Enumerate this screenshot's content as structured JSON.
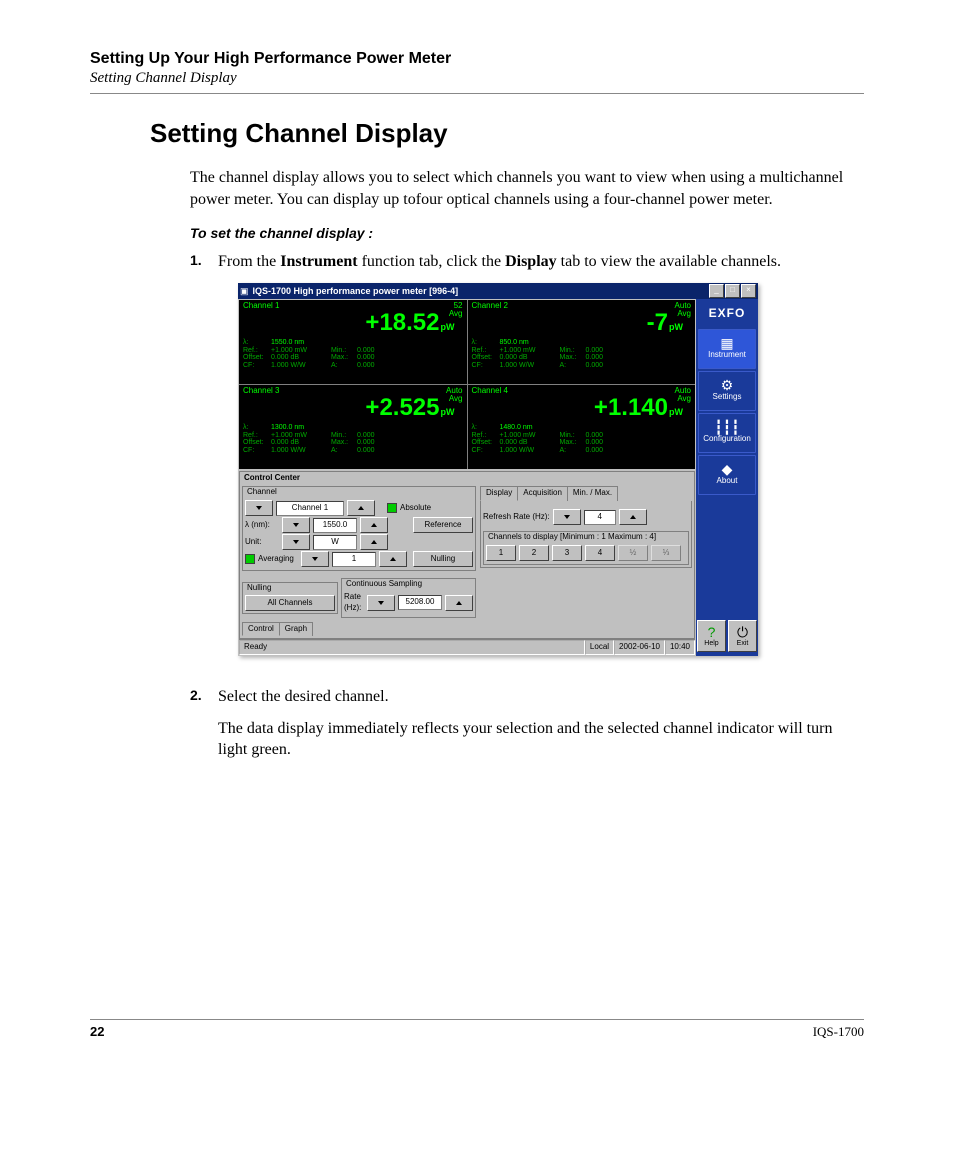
{
  "header": {
    "title": "Setting Up Your High Performance Power Meter",
    "sub": "Setting Channel Display"
  },
  "h1": "Setting Channel Display",
  "intro": "The channel display allows you to select which channels you want to view when using a multichannel power meter. You can display up tofour optical channels using a four-channel power meter.",
  "instr": "To set the channel display :",
  "step1": {
    "n": "1.",
    "pre": "From the ",
    "b1": "Instrument",
    "mid": " function tab, click the ",
    "b2": "Display",
    "post": " tab to view the available channels."
  },
  "step2": {
    "n": "2.",
    "line1": "Select the desired channel.",
    "line2": "The data display immediately reflects your selection and the selected channel indicator will turn light green."
  },
  "footer": {
    "page": "22",
    "model": "IQS-1700"
  },
  "shot": {
    "title": "IQS-1700 High performance power meter [996-4]",
    "winbtns": {
      "min": "_",
      "max": "□",
      "close": "×"
    },
    "logo": "EXFO",
    "side": [
      {
        "l": "Instrument"
      },
      {
        "l": "Settings"
      },
      {
        "l": "Configuration"
      },
      {
        "l": "About"
      }
    ],
    "help": "Help",
    "exit": "Exit",
    "channels": [
      {
        "name": "Channel 1",
        "auto1": "52",
        "auto2": "Avg",
        "value": "+18.52",
        "unit": "pW",
        "lambda": "1550.0 nm",
        "ref": "+1.000  mW",
        "off": "0.000  dB",
        "cf": "1.000  W/W",
        "min": "0.000",
        "max": "0.000",
        "a": "0.000"
      },
      {
        "name": "Channel 2",
        "auto1": "Auto",
        "auto2": "Avg",
        "value": "-7",
        "unit": "pW",
        "lambda": "850.0 nm",
        "ref": "+1.000  mW",
        "off": "0.000  dB",
        "cf": "1.000  W/W",
        "min": "0.000",
        "max": "0.000",
        "a": "0.000"
      },
      {
        "name": "Channel 3",
        "auto1": "Auto",
        "auto2": "Avg",
        "value": "+2.525",
        "unit": "pW",
        "lambda": "1300.0 nm",
        "ref": "+1.000  mW",
        "off": "0.000  dB",
        "cf": "1.000  W/W",
        "min": "0.000",
        "max": "0.000",
        "a": "0.000"
      },
      {
        "name": "Channel 4",
        "auto1": "Auto",
        "auto2": "Avg",
        "value": "+1.140",
        "unit": "pW",
        "lambda": "1480.0 nm",
        "ref": "+1.000  mW",
        "off": "0.000  dB",
        "cf": "1.000  W/W",
        "min": "0.000",
        "max": "0.000",
        "a": "0.000"
      }
    ],
    "plabels": {
      "l": "λ:",
      "ref": "Ref.:",
      "off": "Offset:",
      "cf": "CF:",
      "min": "Min.:",
      "max": "Max.:",
      "a": "A:"
    },
    "cc": "Control Center",
    "chpanel": {
      "t": "Channel",
      "sel": "Channel 1",
      "abs": "Absolute",
      "lambda": "λ  (nm):",
      "lambdav": "1550.0",
      "unit": "Unit:",
      "unitv": "W",
      "avg": "Averaging",
      "avgv": "1",
      "ref": "Reference",
      "null": "Nulling"
    },
    "nulling": {
      "t": "Nulling",
      "btn": "All Channels"
    },
    "cs": {
      "t": "Continuous Sampling",
      "l": "Rate (Hz):",
      "v": "5208.00"
    },
    "btabs": {
      "a": "Control",
      "b": "Graph"
    },
    "rtabs": {
      "a": "Display",
      "b": "Acquisition",
      "c": "Min. / Max."
    },
    "refresh": {
      "l": "Refresh Rate (Hz):",
      "v": "4"
    },
    "chdisp": {
      "t": "Channels to display [Minimum : 1  Maximum : 4]",
      "b": [
        "1",
        "2",
        "3",
        "4",
        "½",
        "⅓"
      ]
    },
    "status": {
      "ready": "Ready",
      "local": "Local",
      "date": "2002-06-10",
      "time": "10:40"
    }
  }
}
